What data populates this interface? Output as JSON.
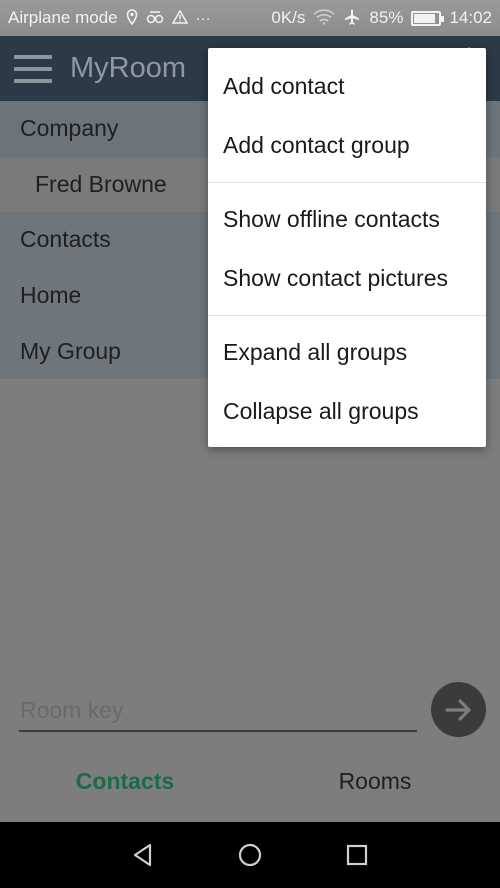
{
  "status_bar": {
    "airplane_mode": "Airplane mode",
    "speed": "0K/s",
    "battery": "85%",
    "battery_level": 0.85,
    "time": "14:02",
    "icons": [
      "location-icon",
      "roaming-icon",
      "warning-icon",
      "more-icon",
      "wifi-icon",
      "airplane-icon",
      "battery-icon"
    ]
  },
  "app_bar": {
    "title": "MyRoom",
    "background": "#2b3a46"
  },
  "contacts_list": {
    "items": [
      {
        "label": "Company",
        "kind": "group"
      },
      {
        "label": "Fred Browne",
        "kind": "contact"
      },
      {
        "label": "Contacts",
        "kind": "group"
      },
      {
        "label": "Home",
        "kind": "group"
      },
      {
        "label": "My Group",
        "kind": "group"
      }
    ]
  },
  "room_key": {
    "value": "",
    "placeholder": "Room key"
  },
  "tabs": [
    {
      "label": "Contacts",
      "active": true
    },
    {
      "label": "Rooms",
      "active": false
    }
  ],
  "accent_color": "#1a6b47",
  "menu": {
    "sections": [
      [
        "Add contact",
        "Add contact group"
      ],
      [
        "Show offline contacts",
        "Show contact pictures"
      ],
      [
        "Expand all groups",
        "Collapse all groups"
      ]
    ]
  }
}
